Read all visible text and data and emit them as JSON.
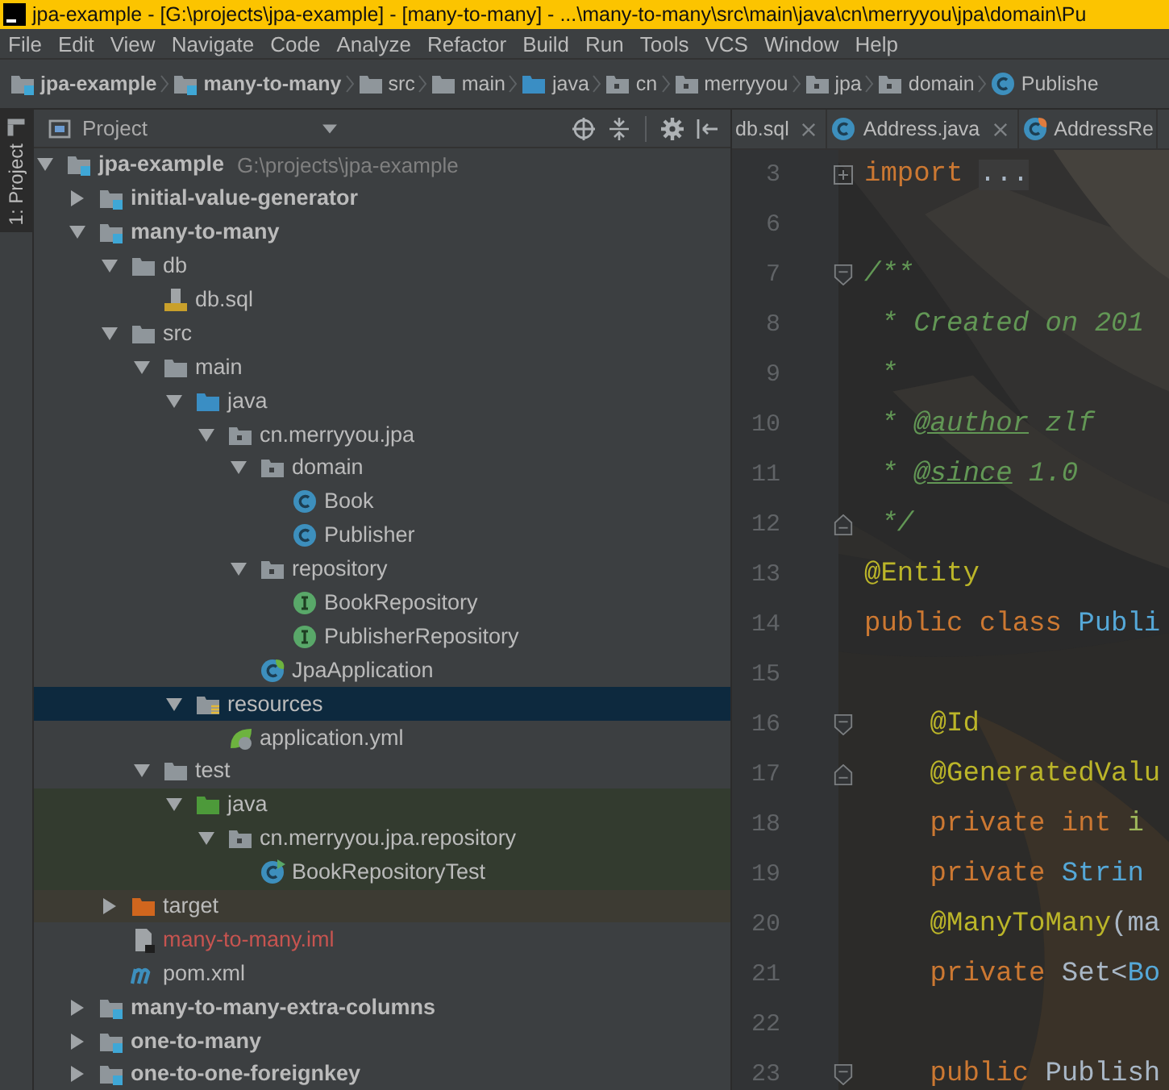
{
  "title_bar": {
    "title": "jpa-example - [G:\\projects\\jpa-example] - [many-to-many] - ...\\many-to-many\\src\\main\\java\\cn\\merryyou\\jpa\\domain\\Pu"
  },
  "menu": [
    "File",
    "Edit",
    "View",
    "Navigate",
    "Code",
    "Analyze",
    "Refactor",
    "Build",
    "Run",
    "Tools",
    "VCS",
    "Window",
    "Help"
  ],
  "breadcrumbs": [
    {
      "label": "jpa-example",
      "kind": "module"
    },
    {
      "label": "many-to-many",
      "kind": "module"
    },
    {
      "label": "src",
      "kind": "folder"
    },
    {
      "label": "main",
      "kind": "folder"
    },
    {
      "label": "java",
      "kind": "source-folder"
    },
    {
      "label": "cn",
      "kind": "package"
    },
    {
      "label": "merryyou",
      "kind": "package"
    },
    {
      "label": "jpa",
      "kind": "package"
    },
    {
      "label": "domain",
      "kind": "package"
    },
    {
      "label": "Publishe",
      "kind": "class"
    }
  ],
  "tool_stripe": {
    "label": "1: Project",
    "selected": true
  },
  "project_panel": {
    "title": "Project",
    "tree": [
      {
        "label": "jpa-example",
        "path": "G:\\projects\\jpa-example",
        "kind": "module",
        "expanded": true,
        "selected": false,
        "children": [
          {
            "label": "initial-value-generator",
            "kind": "module",
            "expanded": false,
            "selected": false
          },
          {
            "label": "many-to-many",
            "kind": "module",
            "expanded": true,
            "selected": false,
            "children": [
              {
                "label": "db",
                "kind": "folder",
                "expanded": true,
                "selected": false,
                "children": [
                  {
                    "label": "db.sql",
                    "kind": "sql",
                    "selected": false
                  }
                ]
              },
              {
                "label": "src",
                "kind": "folder",
                "expanded": true,
                "selected": false,
                "children": [
                  {
                    "label": "main",
                    "kind": "folder",
                    "expanded": true,
                    "selected": false,
                    "children": [
                      {
                        "label": "java",
                        "kind": "source-folder",
                        "expanded": true,
                        "selected": false,
                        "children": [
                          {
                            "label": "cn.merryyou.jpa",
                            "kind": "package",
                            "expanded": true,
                            "selected": false,
                            "children": [
                              {
                                "label": "domain",
                                "kind": "package",
                                "expanded": true,
                                "selected": false,
                                "children": [
                                  {
                                    "label": "Book",
                                    "kind": "class",
                                    "selected": false
                                  },
                                  {
                                    "label": "Publisher",
                                    "kind": "class",
                                    "selected": false
                                  }
                                ]
                              },
                              {
                                "label": "repository",
                                "kind": "package",
                                "expanded": true,
                                "selected": false,
                                "children": [
                                  {
                                    "label": "BookRepository",
                                    "kind": "interface",
                                    "selected": false
                                  },
                                  {
                                    "label": "PublisherRepository",
                                    "kind": "interface",
                                    "selected": false
                                  }
                                ]
                              },
                              {
                                "label": "JpaApplication",
                                "kind": "spring-class",
                                "selected": false
                              }
                            ]
                          }
                        ]
                      },
                      {
                        "label": "resources",
                        "kind": "resources",
                        "expanded": true,
                        "selected": true,
                        "children": [
                          {
                            "label": "application.yml",
                            "kind": "spring-config",
                            "selected": false
                          }
                        ]
                      }
                    ]
                  },
                  {
                    "label": "test",
                    "kind": "folder",
                    "expanded": true,
                    "selected": false,
                    "children": [
                      {
                        "label": "java",
                        "kind": "test-folder",
                        "expanded": true,
                        "selected": false,
                        "color": "#333b2f",
                        "children": [
                          {
                            "label": "cn.merryyou.jpa.repository",
                            "kind": "package",
                            "expanded": true,
                            "selected": false,
                            "color": "#333b2f",
                            "children": [
                              {
                                "label": "BookRepositoryTest",
                                "kind": "test-class",
                                "selected": false,
                                "color": "#333b2f"
                              }
                            ]
                          }
                        ]
                      }
                    ]
                  }
                ]
              },
              {
                "label": "target",
                "kind": "excluded",
                "expanded": false,
                "selected": false,
                "color": "#3d3b33"
              },
              {
                "label": "many-to-many.iml",
                "kind": "iml",
                "selected": false
              },
              {
                "label": "pom.xml",
                "kind": "maven",
                "selected": false
              }
            ]
          },
          {
            "label": "many-to-many-extra-columns",
            "kind": "module",
            "expanded": false,
            "selected": false
          },
          {
            "label": "one-to-many",
            "kind": "module",
            "expanded": false,
            "selected": false
          },
          {
            "label": "one-to-one-foreignkey",
            "kind": "module",
            "expanded": false,
            "selected": false
          }
        ]
      }
    ]
  },
  "editor": {
    "tabs": [
      {
        "label": "db.sql",
        "kind": "sql",
        "closable": true
      },
      {
        "label": "Address.java",
        "kind": "class",
        "closable": true
      },
      {
        "label": "AddressRe",
        "kind": "spring-class",
        "closable": false
      }
    ],
    "lines": [
      {
        "number": "3",
        "kind": "fold-collapsed",
        "tokens": [
          {
            "text": "import ",
            "kind": "keyword"
          },
          {
            "text": "...",
            "kind": "folded"
          }
        ]
      },
      {
        "number": "6"
      },
      {
        "number": "7",
        "kind": "fold-start",
        "tokens": [
          {
            "text": "/**",
            "kind": "comment"
          }
        ]
      },
      {
        "number": "8",
        "tokens": [
          {
            "text": " * Created on 201",
            "kind": "comment"
          }
        ]
      },
      {
        "number": "9",
        "tokens": [
          {
            "text": " *",
            "kind": "comment"
          }
        ]
      },
      {
        "number": "10",
        "tokens": [
          {
            "text": " * ",
            "kind": "comment"
          },
          {
            "text": "@author",
            "kind": "doc-tag"
          },
          {
            "text": " zlf",
            "kind": "comment"
          }
        ]
      },
      {
        "number": "11",
        "tokens": [
          {
            "text": " * ",
            "kind": "comment"
          },
          {
            "text": "@since",
            "kind": "doc-tag"
          },
          {
            "text": " 1.0",
            "kind": "comment"
          }
        ]
      },
      {
        "number": "12",
        "kind": "fold-end",
        "tokens": [
          {
            "text": " */",
            "kind": "comment"
          }
        ]
      },
      {
        "number": "13",
        "tokens": [
          {
            "text": "@Entity",
            "kind": "annotation"
          }
        ]
      },
      {
        "number": "14",
        "tokens": [
          {
            "text": "public class ",
            "kind": "keyword"
          },
          {
            "text": "Publi",
            "kind": "type"
          }
        ]
      },
      {
        "number": "15"
      },
      {
        "number": "16",
        "kind": "fold-start",
        "indented": true,
        "tokens": [
          {
            "text": "@Id",
            "kind": "annotation"
          }
        ]
      },
      {
        "number": "17",
        "kind": "fold-end",
        "indented": true,
        "tokens": [
          {
            "text": "@GeneratedValu",
            "kind": "annotation"
          }
        ]
      },
      {
        "number": "18",
        "indented": true,
        "tokens": [
          {
            "text": "private int ",
            "kind": "keyword"
          },
          {
            "text": "i",
            "kind": "field"
          }
        ]
      },
      {
        "number": "19",
        "indented": true,
        "tokens": [
          {
            "text": "private ",
            "kind": "keyword"
          },
          {
            "text": "Strin",
            "kind": "type"
          }
        ]
      },
      {
        "number": "20",
        "indented": true,
        "tokens": [
          {
            "text": "@ManyToMany",
            "kind": "annotation"
          },
          {
            "text": "(ma",
            "kind": "plain"
          }
        ]
      },
      {
        "number": "21",
        "indented": true,
        "tokens": [
          {
            "text": "private ",
            "kind": "keyword"
          },
          {
            "text": "Set<",
            "kind": "plain"
          },
          {
            "text": "Bo",
            "kind": "type"
          }
        ]
      },
      {
        "number": "22"
      },
      {
        "number": "23",
        "kind": "fold-start",
        "indented": true,
        "tokens": [
          {
            "text": "public ",
            "kind": "keyword"
          },
          {
            "text": "Publish",
            "kind": "plain"
          }
        ]
      }
    ]
  }
}
